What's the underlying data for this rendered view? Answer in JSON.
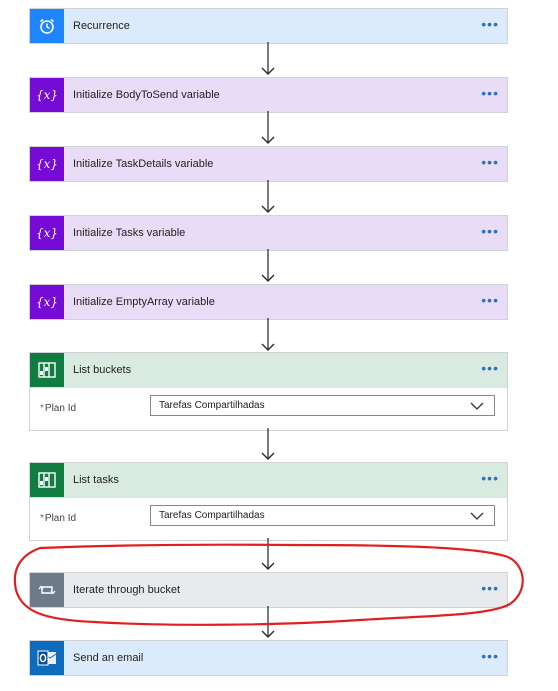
{
  "steps": [
    {
      "title": "Recurrence",
      "icon": "alarm-clock-icon",
      "header_bg": "#dcebfb",
      "icon_bg": "#1f85ff"
    },
    {
      "title": "Initialize BodyToSend variable",
      "icon": "variable-icon",
      "header_bg": "#e9dcf7",
      "icon_bg": "#770bd6"
    },
    {
      "title": "Initialize TaskDetails variable",
      "icon": "variable-icon",
      "header_bg": "#e9dcf7",
      "icon_bg": "#770bd6"
    },
    {
      "title": "Initialize Tasks variable",
      "icon": "variable-icon",
      "header_bg": "#e9dcf7",
      "icon_bg": "#770bd6"
    },
    {
      "title": "Initialize EmptyArray variable",
      "icon": "variable-icon",
      "header_bg": "#e9dcf7",
      "icon_bg": "#770bd6"
    },
    {
      "title": "List buckets",
      "icon": "planner-icon",
      "header_bg": "#d9ebe1",
      "icon_bg": "#107c41",
      "field_label": "Plan Id",
      "required_mark": "*",
      "field_value": "Tarefas Compartilhadas"
    },
    {
      "title": "List tasks",
      "icon": "planner-icon",
      "header_bg": "#d9ebe1",
      "icon_bg": "#107c41",
      "field_label": "Plan Id",
      "required_mark": "*",
      "field_value": "Tarefas Compartilhadas"
    },
    {
      "title": "Iterate through bucket",
      "icon": "loop-icon",
      "header_bg": "#e8eaed",
      "icon_bg": "#6e7a87"
    },
    {
      "title": "Send an email",
      "icon": "outlook-icon",
      "header_bg": "#dcebfb",
      "icon_bg": "#0f6cbd"
    }
  ],
  "more_label": "•••",
  "annotation_color": "#e02020"
}
